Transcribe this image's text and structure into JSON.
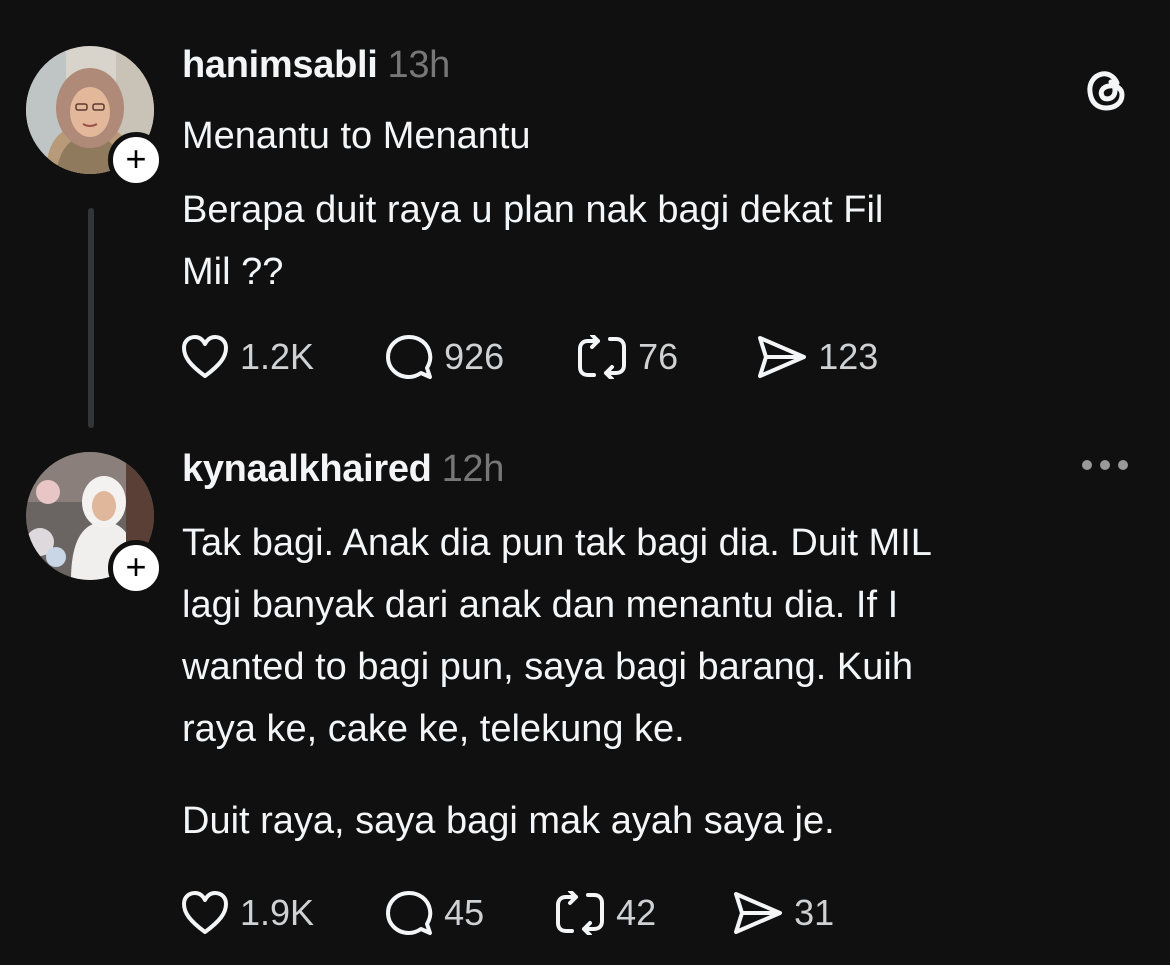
{
  "posts": [
    {
      "username": "hanimsabli",
      "time": "13h",
      "lines": [
        "Menantu to Menantu",
        "Berapa duit raya u plan nak bagi dekat Fil",
        "Mil ??"
      ],
      "likes": "1.2K",
      "replies": "926",
      "reposts": "76",
      "shares": "123"
    },
    {
      "username": "kynaalkhaired",
      "time": "12h",
      "lines": [
        "Tak bagi. Anak dia pun tak bagi dia. Duit MIL",
        "lagi banyak dari anak dan menantu dia. If I",
        "wanted to bagi pun, saya bagi barang. Kuih",
        "raya ke, cake ke, telekung ke."
      ],
      "paragraph2": "Duit raya, saya bagi mak ayah saya je.",
      "likes": "1.9K",
      "replies": "45",
      "reposts": "42",
      "shares": "31"
    }
  ],
  "icons": {
    "logo": "threads-logo-icon",
    "follow": "plus-icon",
    "like": "heart-icon",
    "reply": "comment-icon",
    "repost": "repost-icon",
    "share": "send-icon",
    "more": "more-icon"
  },
  "colors": {
    "background": "#101010",
    "text": "#f3f5f7",
    "muted": "#777777"
  }
}
